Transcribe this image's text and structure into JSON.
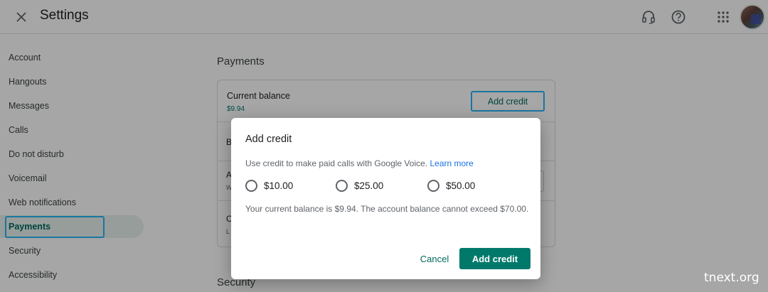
{
  "header": {
    "title": "Settings",
    "icons": {
      "close": "close-icon",
      "support": "headset-icon",
      "help": "help-icon",
      "apps": "apps-grid-icon"
    }
  },
  "sidebar": {
    "items": [
      {
        "label": "Account"
      },
      {
        "label": "Hangouts"
      },
      {
        "label": "Messages"
      },
      {
        "label": "Calls"
      },
      {
        "label": "Do not disturb"
      },
      {
        "label": "Voicemail"
      },
      {
        "label": "Web notifications"
      },
      {
        "label": "Payments",
        "active": true
      },
      {
        "label": "Security"
      },
      {
        "label": "Accessibility"
      }
    ]
  },
  "main": {
    "payments_title": "Payments",
    "security_title": "Security",
    "balance_label": "Current balance",
    "balance_value": "$9.94",
    "add_credit_label": "Add credit",
    "hidden_rows": [
      "B",
      "A",
      "W",
      "C",
      "L"
    ]
  },
  "dialog": {
    "title": "Add credit",
    "description": "Use credit to make paid calls with Google Voice.",
    "learn_more": "Learn more",
    "options": [
      {
        "label": "$10.00"
      },
      {
        "label": "$25.00"
      },
      {
        "label": "$50.00"
      }
    ],
    "note": "Your current balance is $9.94. The account balance cannot exceed $70.00.",
    "cancel_label": "Cancel",
    "submit_label": "Add credit"
  },
  "colors": {
    "accent": "#00796b",
    "link": "#1a73e8",
    "focus": "#29b6f6"
  },
  "watermark": "tnext.org"
}
